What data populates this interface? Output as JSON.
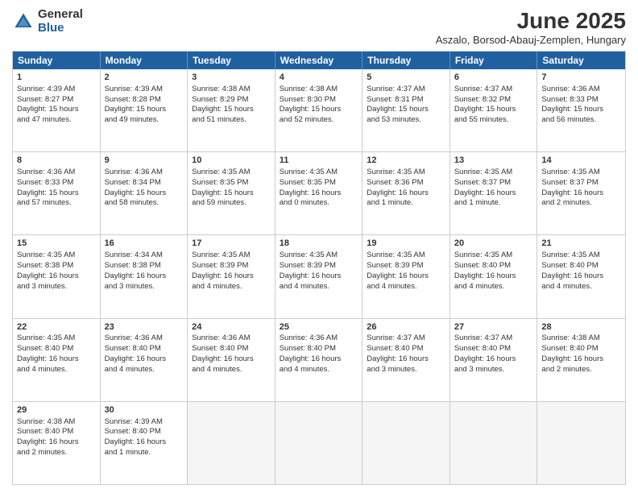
{
  "logo": {
    "general": "General",
    "blue": "Blue"
  },
  "title": "June 2025",
  "subtitle": "Aszalo, Borsod-Abauj-Zemplen, Hungary",
  "header_days": [
    "Sunday",
    "Monday",
    "Tuesday",
    "Wednesday",
    "Thursday",
    "Friday",
    "Saturday"
  ],
  "weeks": [
    [
      {
        "day": "1",
        "lines": [
          "Sunrise: 4:39 AM",
          "Sunset: 8:27 PM",
          "Daylight: 15 hours",
          "and 47 minutes."
        ]
      },
      {
        "day": "2",
        "lines": [
          "Sunrise: 4:39 AM",
          "Sunset: 8:28 PM",
          "Daylight: 15 hours",
          "and 49 minutes."
        ]
      },
      {
        "day": "3",
        "lines": [
          "Sunrise: 4:38 AM",
          "Sunset: 8:29 PM",
          "Daylight: 15 hours",
          "and 51 minutes."
        ]
      },
      {
        "day": "4",
        "lines": [
          "Sunrise: 4:38 AM",
          "Sunset: 8:30 PM",
          "Daylight: 15 hours",
          "and 52 minutes."
        ]
      },
      {
        "day": "5",
        "lines": [
          "Sunrise: 4:37 AM",
          "Sunset: 8:31 PM",
          "Daylight: 15 hours",
          "and 53 minutes."
        ]
      },
      {
        "day": "6",
        "lines": [
          "Sunrise: 4:37 AM",
          "Sunset: 8:32 PM",
          "Daylight: 15 hours",
          "and 55 minutes."
        ]
      },
      {
        "day": "7",
        "lines": [
          "Sunrise: 4:36 AM",
          "Sunset: 8:33 PM",
          "Daylight: 15 hours",
          "and 56 minutes."
        ]
      }
    ],
    [
      {
        "day": "8",
        "lines": [
          "Sunrise: 4:36 AM",
          "Sunset: 8:33 PM",
          "Daylight: 15 hours",
          "and 57 minutes."
        ]
      },
      {
        "day": "9",
        "lines": [
          "Sunrise: 4:36 AM",
          "Sunset: 8:34 PM",
          "Daylight: 15 hours",
          "and 58 minutes."
        ]
      },
      {
        "day": "10",
        "lines": [
          "Sunrise: 4:35 AM",
          "Sunset: 8:35 PM",
          "Daylight: 15 hours",
          "and 59 minutes."
        ]
      },
      {
        "day": "11",
        "lines": [
          "Sunrise: 4:35 AM",
          "Sunset: 8:35 PM",
          "Daylight: 16 hours",
          "and 0 minutes."
        ]
      },
      {
        "day": "12",
        "lines": [
          "Sunrise: 4:35 AM",
          "Sunset: 8:36 PM",
          "Daylight: 16 hours",
          "and 1 minute."
        ]
      },
      {
        "day": "13",
        "lines": [
          "Sunrise: 4:35 AM",
          "Sunset: 8:37 PM",
          "Daylight: 16 hours",
          "and 1 minute."
        ]
      },
      {
        "day": "14",
        "lines": [
          "Sunrise: 4:35 AM",
          "Sunset: 8:37 PM",
          "Daylight: 16 hours",
          "and 2 minutes."
        ]
      }
    ],
    [
      {
        "day": "15",
        "lines": [
          "Sunrise: 4:35 AM",
          "Sunset: 8:38 PM",
          "Daylight: 16 hours",
          "and 3 minutes."
        ]
      },
      {
        "day": "16",
        "lines": [
          "Sunrise: 4:34 AM",
          "Sunset: 8:38 PM",
          "Daylight: 16 hours",
          "and 3 minutes."
        ]
      },
      {
        "day": "17",
        "lines": [
          "Sunrise: 4:35 AM",
          "Sunset: 8:39 PM",
          "Daylight: 16 hours",
          "and 4 minutes."
        ]
      },
      {
        "day": "18",
        "lines": [
          "Sunrise: 4:35 AM",
          "Sunset: 8:39 PM",
          "Daylight: 16 hours",
          "and 4 minutes."
        ]
      },
      {
        "day": "19",
        "lines": [
          "Sunrise: 4:35 AM",
          "Sunset: 8:39 PM",
          "Daylight: 16 hours",
          "and 4 minutes."
        ]
      },
      {
        "day": "20",
        "lines": [
          "Sunrise: 4:35 AM",
          "Sunset: 8:40 PM",
          "Daylight: 16 hours",
          "and 4 minutes."
        ]
      },
      {
        "day": "21",
        "lines": [
          "Sunrise: 4:35 AM",
          "Sunset: 8:40 PM",
          "Daylight: 16 hours",
          "and 4 minutes."
        ]
      }
    ],
    [
      {
        "day": "22",
        "lines": [
          "Sunrise: 4:35 AM",
          "Sunset: 8:40 PM",
          "Daylight: 16 hours",
          "and 4 minutes."
        ]
      },
      {
        "day": "23",
        "lines": [
          "Sunrise: 4:36 AM",
          "Sunset: 8:40 PM",
          "Daylight: 16 hours",
          "and 4 minutes."
        ]
      },
      {
        "day": "24",
        "lines": [
          "Sunrise: 4:36 AM",
          "Sunset: 8:40 PM",
          "Daylight: 16 hours",
          "and 4 minutes."
        ]
      },
      {
        "day": "25",
        "lines": [
          "Sunrise: 4:36 AM",
          "Sunset: 8:40 PM",
          "Daylight: 16 hours",
          "and 4 minutes."
        ]
      },
      {
        "day": "26",
        "lines": [
          "Sunrise: 4:37 AM",
          "Sunset: 8:40 PM",
          "Daylight: 16 hours",
          "and 3 minutes."
        ]
      },
      {
        "day": "27",
        "lines": [
          "Sunrise: 4:37 AM",
          "Sunset: 8:40 PM",
          "Daylight: 16 hours",
          "and 3 minutes."
        ]
      },
      {
        "day": "28",
        "lines": [
          "Sunrise: 4:38 AM",
          "Sunset: 8:40 PM",
          "Daylight: 16 hours",
          "and 2 minutes."
        ]
      }
    ],
    [
      {
        "day": "29",
        "lines": [
          "Sunrise: 4:38 AM",
          "Sunset: 8:40 PM",
          "Daylight: 16 hours",
          "and 2 minutes."
        ]
      },
      {
        "day": "30",
        "lines": [
          "Sunrise: 4:39 AM",
          "Sunset: 8:40 PM",
          "Daylight: 16 hours",
          "and 1 minute."
        ]
      },
      {
        "day": "",
        "lines": []
      },
      {
        "day": "",
        "lines": []
      },
      {
        "day": "",
        "lines": []
      },
      {
        "day": "",
        "lines": []
      },
      {
        "day": "",
        "lines": []
      }
    ]
  ]
}
